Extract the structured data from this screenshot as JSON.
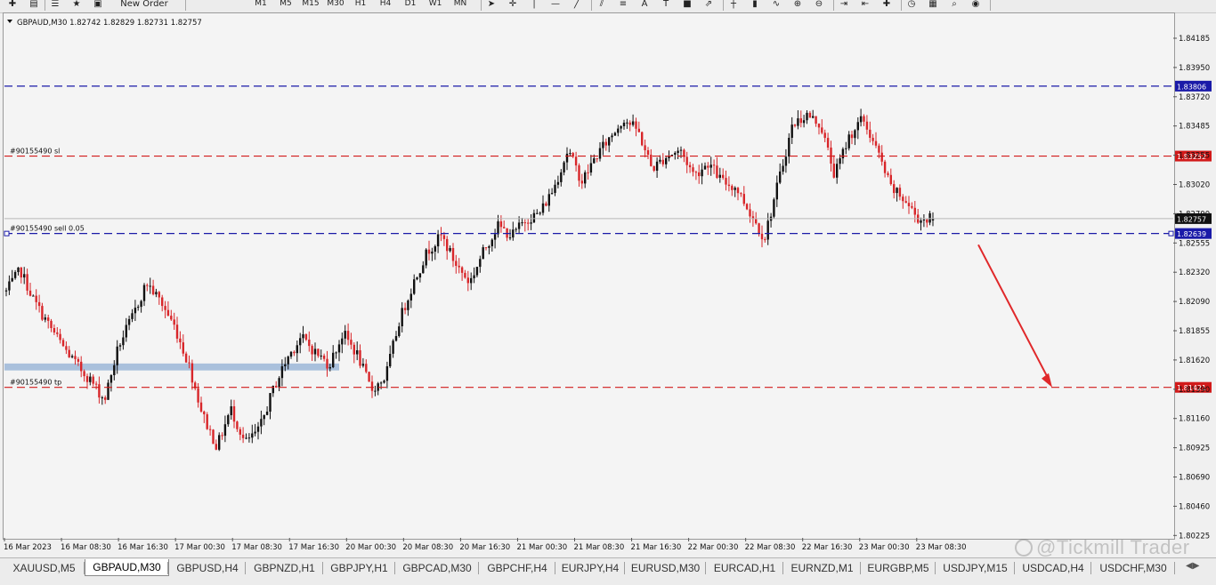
{
  "toolbar": {
    "new_order_label": "New Order",
    "timeframes": [
      "M1",
      "M5",
      "M15",
      "M30",
      "H1",
      "H4",
      "D1",
      "W1",
      "MN"
    ],
    "drawing_labels": [
      "A",
      "T"
    ],
    "icons": [
      "new-chart-icon",
      "profiles-icon",
      "market-watch-icon",
      "favorites-icon",
      "navigator-icon",
      "cursor-icon",
      "crosshair-icon",
      "vertical-line-icon",
      "horizontal-line-icon",
      "trendline-icon",
      "channel-icon",
      "fibonacci-icon",
      "text-icon",
      "label-icon",
      "rectangle-icon",
      "arrows-icon",
      "bar-chart-icon",
      "candlestick-icon",
      "line-chart-icon",
      "zoom-in-icon",
      "zoom-out-icon",
      "autoscroll-icon",
      "chart-shift-icon",
      "indicators-icon",
      "periods-icon",
      "templates-icon",
      "search-icon",
      "alerts-icon"
    ]
  },
  "chart": {
    "header": "GBPAUD,M30  1.82742 1.82829 1.82731 1.82757",
    "symbol": "GBPAUD",
    "timeframe": "M30",
    "ohlc": [
      "1.82742",
      "1.82829",
      "1.82731",
      "1.82757"
    ],
    "price_axis_ticks": [
      "1.84185",
      "1.83950",
      "1.83720",
      "1.83485",
      "1.83255",
      "1.83020",
      "1.82790",
      "1.82555",
      "1.82320",
      "1.82090",
      "1.81855",
      "1.81620",
      "1.81390",
      "1.81160",
      "1.80925",
      "1.80690",
      "1.80460",
      "1.80225"
    ],
    "time_axis_labels": [
      "16 Mar 2023",
      "16 Mar 08:30",
      "16 Mar 16:30",
      "17 Mar 00:30",
      "17 Mar 08:30",
      "17 Mar 16:30",
      "20 Mar 00:30",
      "20 Mar 08:30",
      "20 Mar 16:30",
      "21 Mar 00:30",
      "21 Mar 08:30",
      "21 Mar 16:30",
      "22 Mar 00:30",
      "22 Mar 08:30",
      "22 Mar 16:30",
      "23 Mar 00:30",
      "23 Mar 08:30"
    ],
    "horizontal_lines": [
      {
        "price": 1.83806,
        "label": "1.83806",
        "color": "#1a1aa8",
        "object_text": ""
      },
      {
        "price": 1.83252,
        "label": "1.83252",
        "color": "#d21a1a",
        "object_text": "#90155490 sl"
      },
      {
        "price": 1.82639,
        "label": "1.82639",
        "color": "#1a1aa8",
        "object_text": "#90155490 sell 0.05"
      },
      {
        "price": 1.81421,
        "label": "1.81421",
        "color": "#d21a1a",
        "object_text": "#90155490 tp"
      }
    ],
    "current_price": {
      "price": 1.82757,
      "label": "1.82757"
    },
    "support_zone": {
      "price_low": 1.81555,
      "price_high": 1.8161,
      "color": "#a9c0dc"
    },
    "arrow": {
      "from_price": 1.8255,
      "to_price": 1.81421,
      "color": "#e0282a"
    },
    "colors": {
      "bull": "#111111",
      "bear": "#d8262a",
      "background": "#f4f4f4",
      "grid": "#cfcfcf"
    }
  },
  "chart_data": {
    "type": "candlestick",
    "symbol": "GBPAUD",
    "timeframe": "M30",
    "ylim": [
      1.8015,
      1.8435
    ],
    "keypoints_close": [
      [
        0,
        1.8218
      ],
      [
        10,
        1.8235
      ],
      [
        20,
        1.821
      ],
      [
        30,
        1.8192
      ],
      [
        40,
        1.8175
      ],
      [
        50,
        1.816
      ],
      [
        60,
        1.8148
      ],
      [
        70,
        1.8132
      ],
      [
        80,
        1.8175
      ],
      [
        90,
        1.8198
      ],
      [
        100,
        1.8225
      ],
      [
        110,
        1.821
      ],
      [
        120,
        1.819
      ],
      [
        130,
        1.816
      ],
      [
        140,
        1.812
      ],
      [
        150,
        1.8095
      ],
      [
        160,
        1.8125
      ],
      [
        170,
        1.8098
      ],
      [
        180,
        1.8108
      ],
      [
        190,
        1.814
      ],
      [
        200,
        1.8165
      ],
      [
        210,
        1.8182
      ],
      [
        220,
        1.817
      ],
      [
        230,
        1.816
      ],
      [
        240,
        1.8185
      ],
      [
        250,
        1.8168
      ],
      [
        260,
        1.814
      ],
      [
        270,
        1.815
      ],
      [
        280,
        1.8195
      ],
      [
        290,
        1.8225
      ],
      [
        300,
        1.825
      ],
      [
        310,
        1.8262
      ],
      [
        320,
        1.824
      ],
      [
        330,
        1.8225
      ],
      [
        340,
        1.825
      ],
      [
        350,
        1.827
      ],
      [
        360,
        1.8262
      ],
      [
        370,
        1.8275
      ],
      [
        380,
        1.828
      ],
      [
        390,
        1.83
      ],
      [
        400,
        1.833
      ],
      [
        410,
        1.8305
      ],
      [
        420,
        1.8325
      ],
      [
        430,
        1.834
      ],
      [
        440,
        1.8355
      ],
      [
        450,
        1.8345
      ],
      [
        460,
        1.8315
      ],
      [
        470,
        1.8325
      ],
      [
        480,
        1.833
      ],
      [
        490,
        1.831
      ],
      [
        500,
        1.832
      ],
      [
        510,
        1.8305
      ],
      [
        520,
        1.83
      ],
      [
        530,
        1.828
      ],
      [
        540,
        1.826
      ],
      [
        550,
        1.8305
      ],
      [
        560,
        1.835
      ],
      [
        570,
        1.8358
      ],
      [
        580,
        1.835
      ],
      [
        590,
        1.831
      ],
      [
        600,
        1.834
      ],
      [
        610,
        1.8355
      ],
      [
        620,
        1.833
      ],
      [
        630,
        1.83
      ],
      [
        640,
        1.829
      ],
      [
        650,
        1.8275
      ],
      [
        660,
        1.8276
      ]
    ],
    "last_ohlc": {
      "open": 1.82742,
      "high": 1.82829,
      "low": 1.82731,
      "close": 1.82757
    }
  },
  "tabs": [
    "XAUUSD,M5",
    "GBPAUD,M30",
    "GBPUSD,H4",
    "GBPNZD,H1",
    "GBPJPY,H1",
    "GBPCAD,M30",
    "GBPCHF,H4",
    "EURJPY,H4",
    "EURUSD,M30",
    "EURCAD,H1",
    "EURNZD,M1",
    "EURGBP,M5",
    "USDJPY,M15",
    "USDCAD,H4",
    "USDCHF,M30"
  ],
  "active_tab": "GBPAUD,M30",
  "watermark": "@Tickmill Trader"
}
